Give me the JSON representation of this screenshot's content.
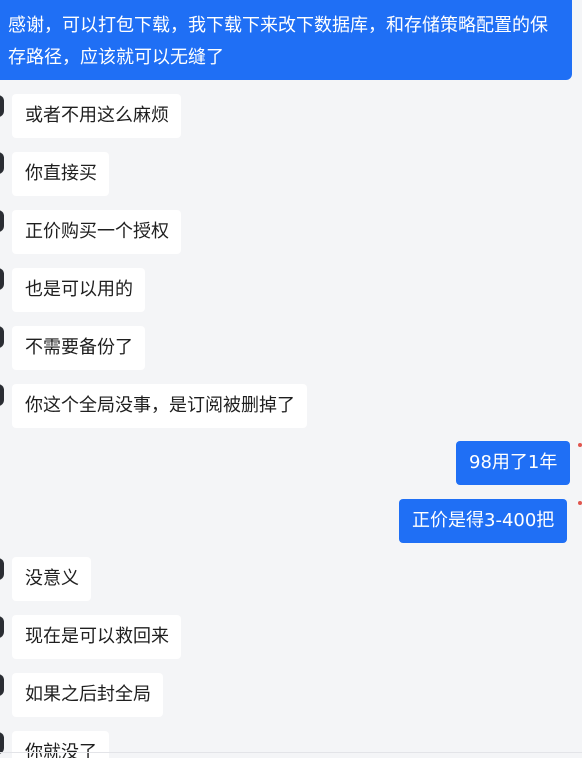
{
  "conversation": {
    "messages": [
      {
        "side": "out",
        "text": "感谢，可以打包下载，我下载下来改下数据库，和存储策略配置的保存路径，应该就可以无缝了"
      },
      {
        "side": "in",
        "text": "或者不用这么麻烦"
      },
      {
        "side": "in",
        "text": "你直接买"
      },
      {
        "side": "in",
        "text": "正价购买一个授权"
      },
      {
        "side": "in",
        "text": "也是可以用的"
      },
      {
        "side": "in",
        "text": "不需要备份了"
      },
      {
        "side": "in",
        "text": "你这个全局没事，是订阅被删掉了"
      },
      {
        "side": "out",
        "text": "98用了1年"
      },
      {
        "side": "out",
        "text": "正价是得3-400把"
      },
      {
        "side": "in",
        "text": "没意义"
      },
      {
        "side": "in",
        "text": "现在是可以救回来"
      },
      {
        "side": "in",
        "text": "如果之后封全局"
      },
      {
        "side": "in",
        "text": "你就没了"
      }
    ]
  },
  "colors": {
    "outgoing_bubble": "#1f6ff5",
    "incoming_bubble": "#ffffff",
    "background": "#f4f5f7",
    "read_mark": "#e0564f"
  }
}
